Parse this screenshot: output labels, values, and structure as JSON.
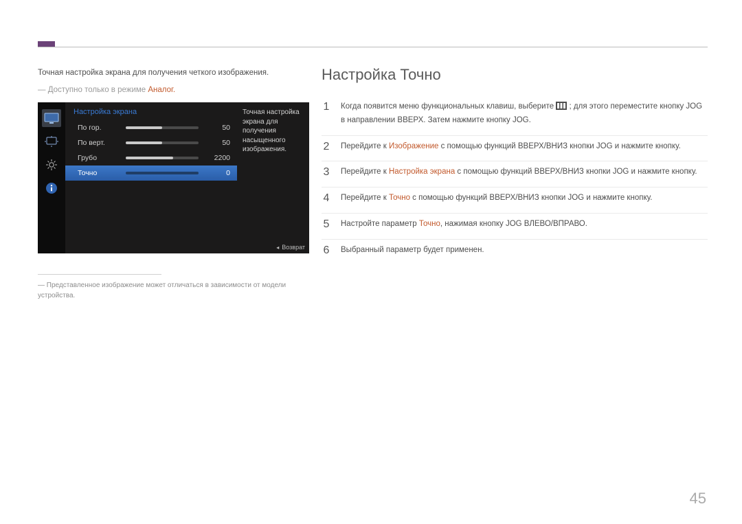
{
  "intro": "Точная настройка экрана для получения четкого изображения.",
  "note_prefix": "― Доступно только в режиме ",
  "note_accent": "Аналог.",
  "osd": {
    "title": "Настройка экрана",
    "rows": [
      {
        "label": "По гор.",
        "value": "50",
        "fill_pct": 50,
        "selected": false
      },
      {
        "label": "По верт.",
        "value": "50",
        "fill_pct": 50,
        "selected": false
      },
      {
        "label": "Грубо",
        "value": "2200",
        "fill_pct": 65,
        "selected": false
      },
      {
        "label": "Точно",
        "value": "0",
        "fill_pct": 0,
        "selected": true
      }
    ],
    "help": "Точная настройка экрана для получения насыщенного изображения.",
    "return": "Возврат"
  },
  "footnote": "― Представленное изображение может отличаться в зависимости от модели устройства.",
  "section_title": "Настройка Точно",
  "steps": [
    {
      "n": "1",
      "parts": [
        {
          "t": "Когда появится меню функциональных клавиш, выберите "
        },
        {
          "icon": "menu"
        },
        {
          "t": " ; для этого переместите кнопку JOG в направлении ВВЕРХ. Затем нажмите кнопку JOG."
        }
      ]
    },
    {
      "n": "2",
      "parts": [
        {
          "t": "Перейдите к "
        },
        {
          "t": "Изображение",
          "accent": true
        },
        {
          "t": " с помощью функций ВВЕРХ/ВНИЗ кнопки JOG и нажмите кнопку."
        }
      ]
    },
    {
      "n": "3",
      "parts": [
        {
          "t": "Перейдите к "
        },
        {
          "t": "Настройка экрана",
          "accent": true
        },
        {
          "t": " с помощью функций ВВЕРХ/ВНИЗ кнопки JOG и нажмите кнопку."
        }
      ]
    },
    {
      "n": "4",
      "parts": [
        {
          "t": "Перейдите к "
        },
        {
          "t": "Точно",
          "accent": true
        },
        {
          "t": " с помощью функций ВВЕРХ/ВНИЗ кнопки JOG и нажмите кнопку."
        }
      ]
    },
    {
      "n": "5",
      "parts": [
        {
          "t": "Настройте параметр "
        },
        {
          "t": "Точно",
          "accent": true
        },
        {
          "t": ", нажимая кнопку JOG ВЛЕВО/ВПРАВО."
        }
      ]
    },
    {
      "n": "6",
      "parts": [
        {
          "t": "Выбранный параметр будет применен."
        }
      ]
    }
  ],
  "page_number": "45"
}
